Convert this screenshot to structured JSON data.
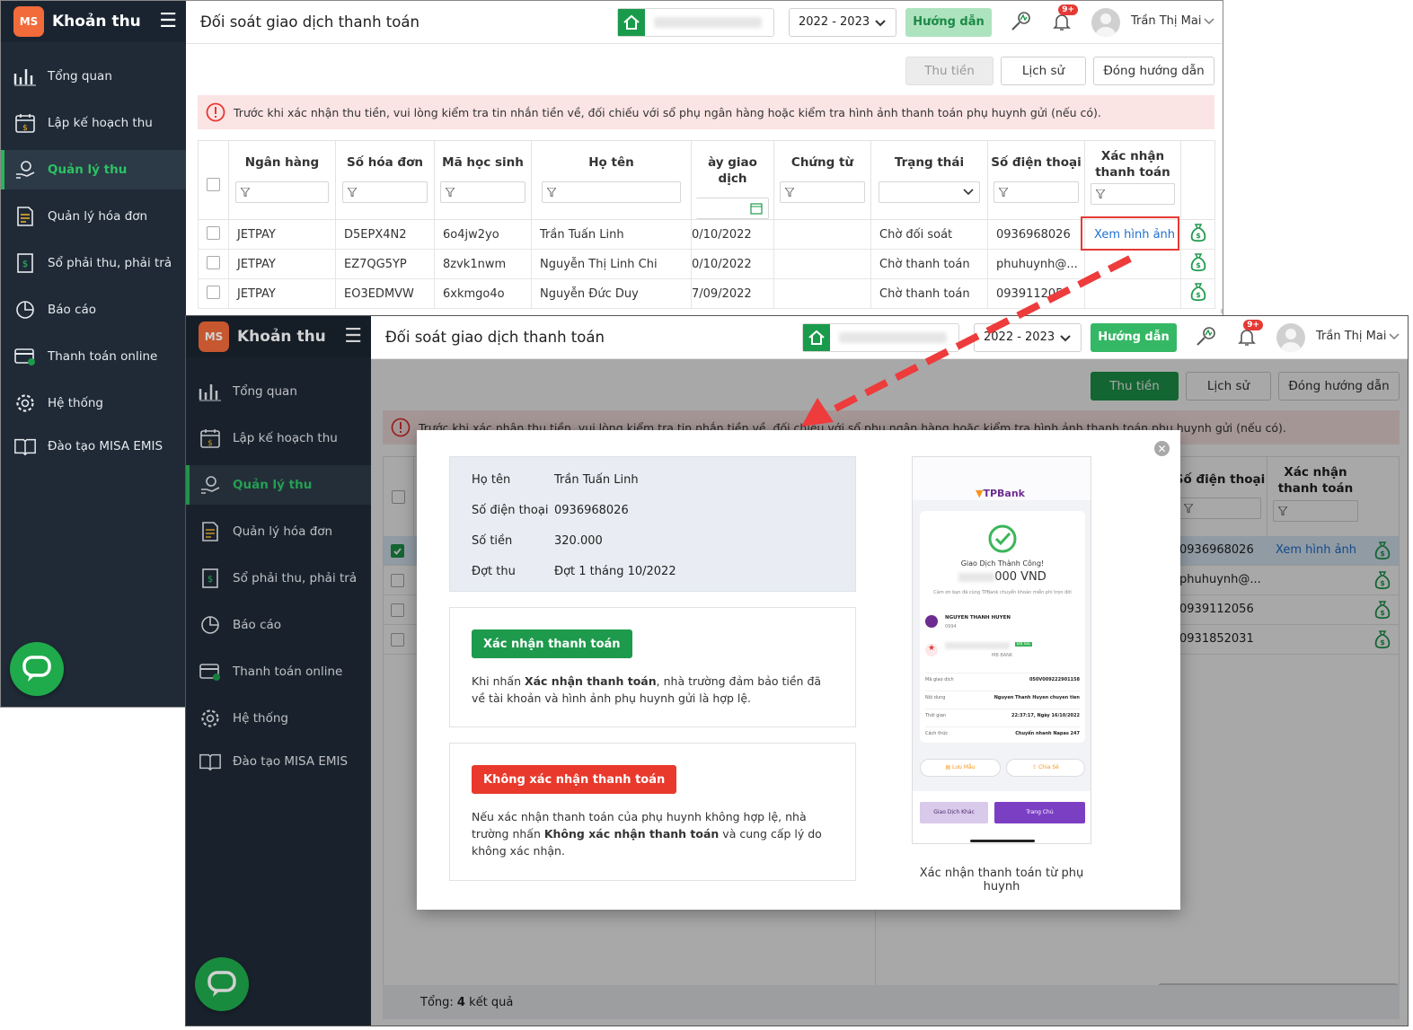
{
  "app": {
    "name": "Khoản thu",
    "logo_text": "MS"
  },
  "sidebar": {
    "items": [
      {
        "label": "Tổng quan",
        "icon": "bar-chart-icon"
      },
      {
        "label": "Lập kế hoạch thu",
        "icon": "calendar-money-icon"
      },
      {
        "label": "Quản lý thu",
        "icon": "hand-coin-icon",
        "active": true
      },
      {
        "label": "Quản lý hóa đơn",
        "icon": "invoice-icon"
      },
      {
        "label": "Sổ phải thu, phải trả",
        "icon": "ledger-icon"
      },
      {
        "label": "Báo cáo",
        "icon": "pie-chart-icon"
      },
      {
        "label": "Thanh toán online",
        "icon": "card-check-icon"
      },
      {
        "label": "Hệ thống",
        "icon": "gear-icon"
      },
      {
        "label": "Đào tạo MISA EMIS",
        "icon": "book-icon"
      }
    ]
  },
  "header": {
    "title": "Đối soát giao dịch thanh toán",
    "school_year": "2022 - 2023",
    "guide_label": "Hướng dẫn",
    "notif_badge": "9+",
    "user_name": "Trần Thị Mai"
  },
  "toolbar": {
    "collect": "Thu tiền",
    "history": "Lịch sử",
    "close_guide": "Đóng hướng dẫn"
  },
  "alert": "Trước khi xác nhận thu tiền, vui lòng kiểm tra tin nhắn tiền về, đối chiếu với sổ phụ ngân hàng hoặc kiểm tra hình ảnh thanh toán phụ huynh gửi (nếu có).",
  "table": {
    "columns": [
      "Ngân hàng",
      "Số hóa đơn",
      "Mã học sinh",
      "Họ tên",
      "ày giao dịch",
      "Chứng từ",
      "Trạng thái",
      "Số điện thoại",
      "Xác nhận\nthanh toán"
    ],
    "rows": [
      {
        "bank": "JETPAY",
        "invoice": "D5EPX4N2",
        "student": "6o4jw2yo",
        "name": "Trần Tuấn Linh",
        "date": "0/10/2022",
        "doc": "",
        "status": "Chờ đối soát",
        "phone": "0936968026",
        "confirm": "Xem hình ảnh"
      },
      {
        "bank": "JETPAY",
        "invoice": "EZ7QG5YP",
        "student": "8zvk1nwm",
        "name": "Nguyễn Thị Linh Chi",
        "date": "0/10/2022",
        "doc": "",
        "status": "Chờ thanh toán",
        "phone": "phuhuynh@...",
        "confirm": ""
      },
      {
        "bank": "JETPAY",
        "invoice": "EO3EDMVW",
        "student": "6xkmgo4o",
        "name": "Nguyễn Đức Duy",
        "date": "7/09/2022",
        "doc": "",
        "status": "Chờ thanh toán",
        "phone": "093911205",
        "confirm": ""
      }
    ]
  },
  "table2": {
    "columns": [
      "Số điện thoại",
      "Xác nhận\nthanh toán"
    ],
    "rows": [
      {
        "phone": "0936968026",
        "confirm": "Xem hình ảnh"
      },
      {
        "phone": "phuhuynh@...",
        "confirm": ""
      },
      {
        "phone": "0939112056",
        "confirm": ""
      },
      {
        "phone": "0931852031",
        "confirm": ""
      }
    ],
    "footer_prefix": "Tổng:",
    "footer_count": "4",
    "footer_suffix": "kết quả"
  },
  "modal": {
    "fields": [
      {
        "label": "Họ tên",
        "value": "Trần Tuấn Linh"
      },
      {
        "label": "Số điện thoại",
        "value": "0936968026"
      },
      {
        "label": "Số tiền",
        "value": "320.000"
      },
      {
        "label": "Đợt thu",
        "value": "Đợt 1 tháng 10/2022"
      }
    ],
    "confirm_btn": "Xác nhận thanh toán",
    "confirm_desc_1": "Khi nhấn ",
    "confirm_desc_bold": "Xác nhận thanh toán",
    "confirm_desc_2": ", nhà trường đảm bảo tiền đã về tài khoản và hình ảnh phụ huynh gửi là hợp lệ.",
    "reject_btn": "Không xác nhận thanh toán",
    "reject_desc_1": "Nếu xác nhận thanh toán của phụ huynh không hợp lệ, nhà trường nhấn ",
    "reject_desc_bold": "Không xác nhận thanh toán",
    "reject_desc_2": " và cung cấp lý do không xác nhận.",
    "caption": "Xác nhận thanh toán từ phụ huynh",
    "receipt": {
      "bank": "TPBank",
      "title": "Giao Dịch Thành Công!",
      "amount": "000 VND",
      "thanks": "Cảm ơn bạn đã cùng TPBank chuyển khoản miễn phí trọn đời",
      "sender": "NGUYEN THANH HUYEN",
      "sender_acc": "0994",
      "receiver_bank": "MB BANK",
      "fields": [
        {
          "k": "Mã giao dịch",
          "v": "050V009222901158"
        },
        {
          "k": "Nội dung",
          "v": "Nguyen Thanh Huyen chuyen tien"
        },
        {
          "k": "Thời gian",
          "v": "22:37:17, Ngày 16/10/2022"
        },
        {
          "k": "Cách thức",
          "v": "Chuyển nhanh Napas 247"
        }
      ],
      "save": "Lưu Mẫu",
      "share": "Chia Sẻ",
      "other": "Giao Dịch Khác",
      "home": "Trang Chủ",
      "tag": "Đã lưu"
    }
  },
  "colors": {
    "sidebar": "#1f2a36",
    "accent": "#1d9a4c",
    "danger": "#e53935",
    "link": "#1f6fd1"
  }
}
